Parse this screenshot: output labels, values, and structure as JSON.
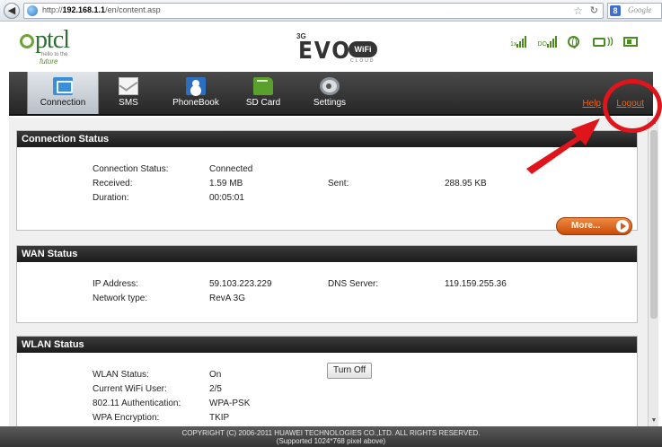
{
  "browser": {
    "url_prefix": "http://",
    "url_host": "192.168.1.1",
    "url_path": "/en/content.asp",
    "search_placeholder": "Google",
    "search_engine_letter": "8"
  },
  "header": {
    "logo_text": "ptcl",
    "logo_tagline": "hello to the",
    "logo_sub": "future",
    "product_3g": "3G",
    "product_name": "EVO",
    "product_badge": "WiFi",
    "product_cloud": "CLOUD",
    "signal_1x": "1x",
    "signal_do": "DO"
  },
  "nav": {
    "tabs": [
      {
        "label": "Connection",
        "icon": "connection-icon"
      },
      {
        "label": "SMS",
        "icon": "sms-icon"
      },
      {
        "label": "PhoneBook",
        "icon": "phonebook-icon"
      },
      {
        "label": "SD Card",
        "icon": "sd-card-icon"
      },
      {
        "label": "Settings",
        "icon": "settings-icon"
      }
    ],
    "active_tab": "Connection",
    "help_label": "Help",
    "logout_label": "Logout"
  },
  "connection_status": {
    "title": "Connection Status",
    "status_label": "Connection Status:",
    "status_value": "Connected",
    "received_label": "Received:",
    "received_value": "1.59 MB",
    "sent_label": "Sent:",
    "sent_value": "288.95 KB",
    "duration_label": "Duration:",
    "duration_value": "00:05:01",
    "more_label": "More..."
  },
  "wan_status": {
    "title": "WAN Status",
    "ip_label": "IP Address:",
    "ip_value": "59.103.223.229",
    "dns_label": "DNS Server:",
    "dns_value": "119.159.255.36",
    "network_label": "Network type:",
    "network_value": "RevA 3G"
  },
  "wlan_status": {
    "title": "WLAN Status",
    "status_label": "WLAN Status:",
    "status_value": "On",
    "turn_off_label": "Turn Off",
    "user_label": "Current WiFi User:",
    "user_value": "2/5",
    "auth_label": "802.11 Authentication:",
    "auth_value": "WPA-PSK",
    "enc_label": "WPA Encryption:",
    "enc_value": "TKIP"
  },
  "footer": {
    "copyright": "COPYRIGHT (C) 2006-2011 HUAWEI TECHNOLOGIES CO.,LTD. ALL RIGHTS RESERVED.",
    "supported": "(Supported 1024*768 pixel above)"
  },
  "colors": {
    "link_orange": "#e8661f",
    "annotation_red": "#e0141b",
    "panel_header": "#1c1c1c",
    "brand_green": "#2e6e34"
  }
}
